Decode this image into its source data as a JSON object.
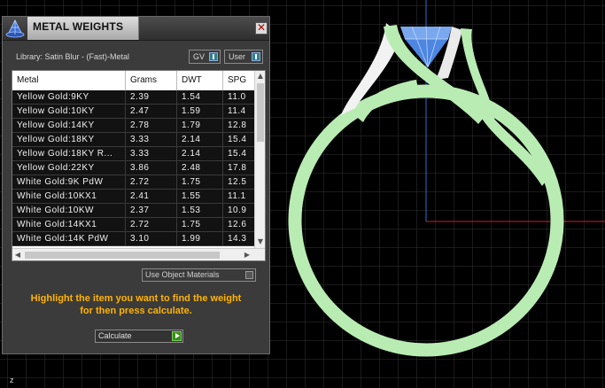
{
  "window": {
    "title": "METAL WEIGHTS",
    "close_glyph": "✕"
  },
  "library": {
    "label": "Library: Satin Blur - (Fast)-Metal"
  },
  "toggles": {
    "gv_label": "GV",
    "user_label": "User"
  },
  "table": {
    "columns": [
      "Metal",
      "Grams",
      "DWT",
      "SPG"
    ],
    "rows": [
      [
        "Yellow Gold:9KY",
        "2.39",
        "1.54",
        "11.0"
      ],
      [
        "Yellow Gold:10KY",
        "2.47",
        "1.59",
        "11.4"
      ],
      [
        "Yellow Gold:14KY",
        "2.78",
        "1.79",
        "12.8"
      ],
      [
        "Yellow Gold:18KY",
        "3.33",
        "2.14",
        "15.4"
      ],
      [
        "Yellow Gold:18KY R...",
        "3.33",
        "2.14",
        "15.4"
      ],
      [
        "Yellow Gold:22KY",
        "3.86",
        "2.48",
        "17.8"
      ],
      [
        "White Gold:9K PdW",
        "2.72",
        "1.75",
        "12.5"
      ],
      [
        "White Gold:10KX1",
        "2.41",
        "1.55",
        "11.1"
      ],
      [
        "White Gold:10KW",
        "2.37",
        "1.53",
        "10.9"
      ],
      [
        "White Gold:14KX1",
        "2.72",
        "1.75",
        "12.6"
      ],
      [
        "White Gold:14K PdW",
        "3.10",
        "1.99",
        "14.3"
      ]
    ]
  },
  "use_object_materials": {
    "label": "Use Object Materials"
  },
  "instruction": {
    "line1": "Highlight the item you want to find the weight",
    "line2": "for then press calculate."
  },
  "calculate": {
    "label": "Calculate"
  },
  "viewport": {
    "axis_label": "z",
    "ring_color": "#b9ecb3",
    "gem_color": "#4d86e0",
    "grid_color": "#3a3a3a",
    "x_axis_color": "#cc2222",
    "y_axis_color": "#2a6fd0"
  },
  "icons": {
    "app": "wizard-hat-icon",
    "close": "close-icon",
    "toggle": "toggle-knob-icon",
    "play": "play-icon"
  }
}
